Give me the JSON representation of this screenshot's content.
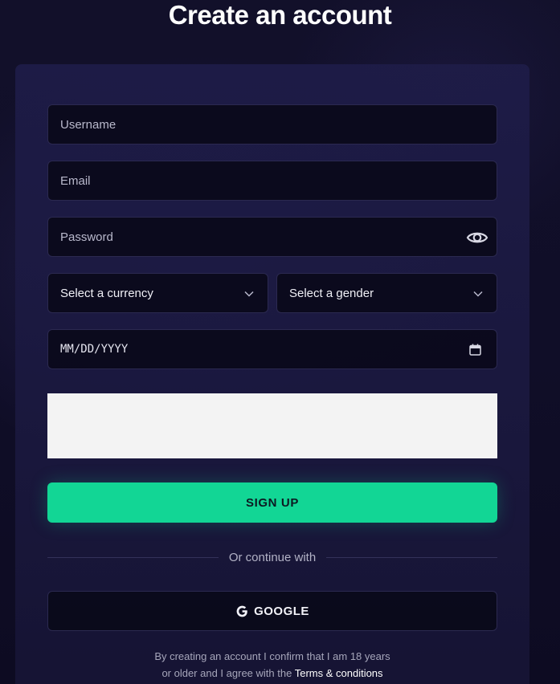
{
  "page": {
    "title": "Create an account"
  },
  "form": {
    "username_placeholder": "Username",
    "email_placeholder": "Email",
    "password_placeholder": "Password",
    "currency_select": "Select a currency",
    "gender_select": "Select a gender",
    "date_placeholder": "MM/DD/YYYY",
    "signup_label": "SIGN UP"
  },
  "social": {
    "divider_text": "Or continue with",
    "google_label": "GOOGLE"
  },
  "legal": {
    "line1": "By creating an account I confirm that I am 18 years",
    "line2_prefix": "or older and I agree with the",
    "terms_link": "Terms & conditions"
  },
  "colors": {
    "accent": "#12d695",
    "background": "#0e0c24",
    "card": "#1e1c48",
    "input": "#0a091a"
  },
  "icons": {
    "password_toggle": "eye-icon",
    "select_arrow": "chevron-down-icon",
    "date_picker": "calendar-icon",
    "google": "google-g-icon"
  }
}
